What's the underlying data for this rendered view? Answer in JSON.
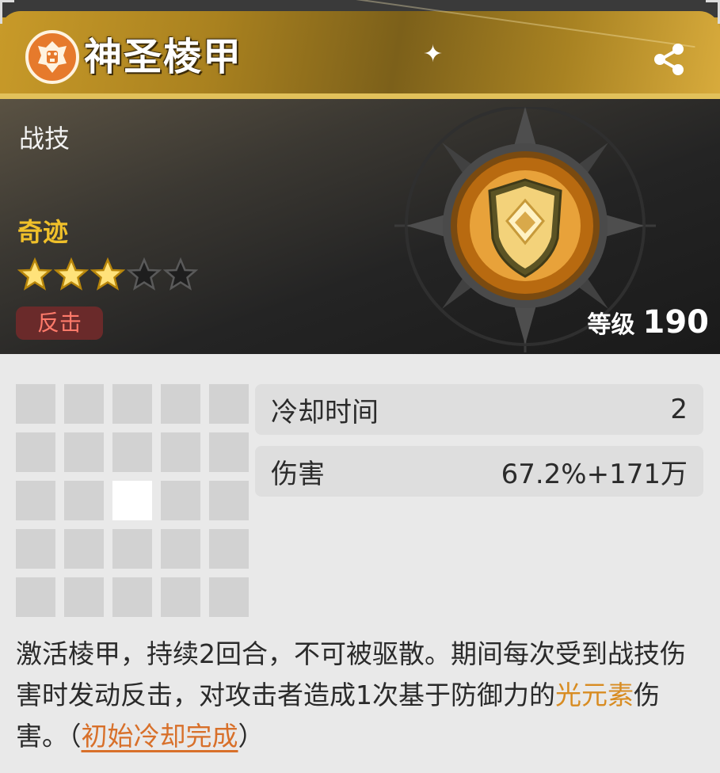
{
  "skill": {
    "name": "神圣棱甲",
    "type": "战技",
    "rarity": "奇迹",
    "stars_filled": 3,
    "stars_total": 5,
    "tag": "反击",
    "level_label": "等级",
    "level_value": "190"
  },
  "stats": [
    {
      "label": "冷却时间",
      "value": "2"
    },
    {
      "label": "伤害",
      "value": "67.2%+171万"
    }
  ],
  "range_grid": {
    "rows": 5,
    "cols": 5,
    "active_cells": [
      [
        2,
        2
      ]
    ]
  },
  "description": {
    "part1": "激活棱甲，持续2回合，不可被驱散。期间每次受到战技伤害时发动反击，对攻击者造成1次基于防御力的",
    "element": "光元素",
    "part2": "伤害。（",
    "link": "初始冷却完成",
    "part3": "）"
  },
  "icons": {
    "emblem": "lion-emblem-icon",
    "share": "share-icon",
    "skill": "shield-skill-icon",
    "sparkle": "sparkle-icon"
  },
  "colors": {
    "header_gold": "#c99c2a",
    "rarity_gold": "#f0c02a",
    "tag_text": "#ff7a6a",
    "element": "#d88c22",
    "link": "#d8702a"
  }
}
